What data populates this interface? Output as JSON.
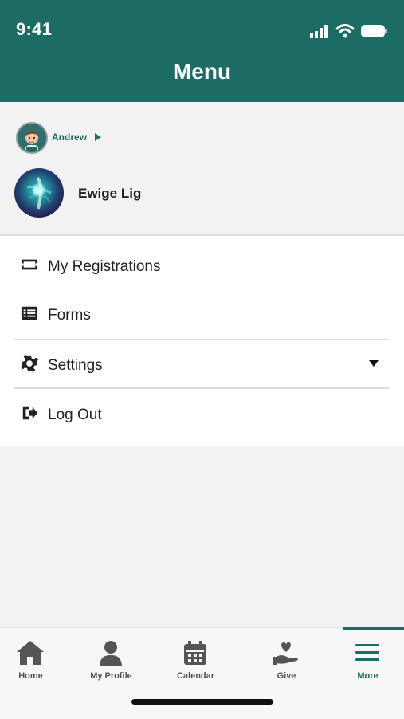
{
  "status_bar": {
    "time": "9:41",
    "icons": [
      "signal-icon",
      "wifi-icon",
      "battery-icon"
    ]
  },
  "header": {
    "title": "Menu",
    "background": "#1d6b65"
  },
  "profile": {
    "account_name": "Andrew",
    "selected_name": "Ewige Lig"
  },
  "menu": {
    "items": [
      {
        "label": "My Registrations",
        "icon": "ticket-icon"
      },
      {
        "label": "Forms",
        "icon": "list-icon"
      },
      {
        "label": "Settings",
        "icon": "gear-icon"
      },
      {
        "label": "Log Out",
        "icon": "logout-icon"
      }
    ]
  },
  "tabbar": {
    "active": "More",
    "tabs": [
      {
        "label": "Home",
        "icon": "home-icon"
      },
      {
        "label": "My Profile",
        "icon": "user-icon"
      },
      {
        "label": "Calendar",
        "icon": "calendar-icon"
      },
      {
        "label": "Give",
        "icon": "give-hand-icon"
      },
      {
        "label": "More",
        "icon": "menu-icon"
      }
    ]
  }
}
